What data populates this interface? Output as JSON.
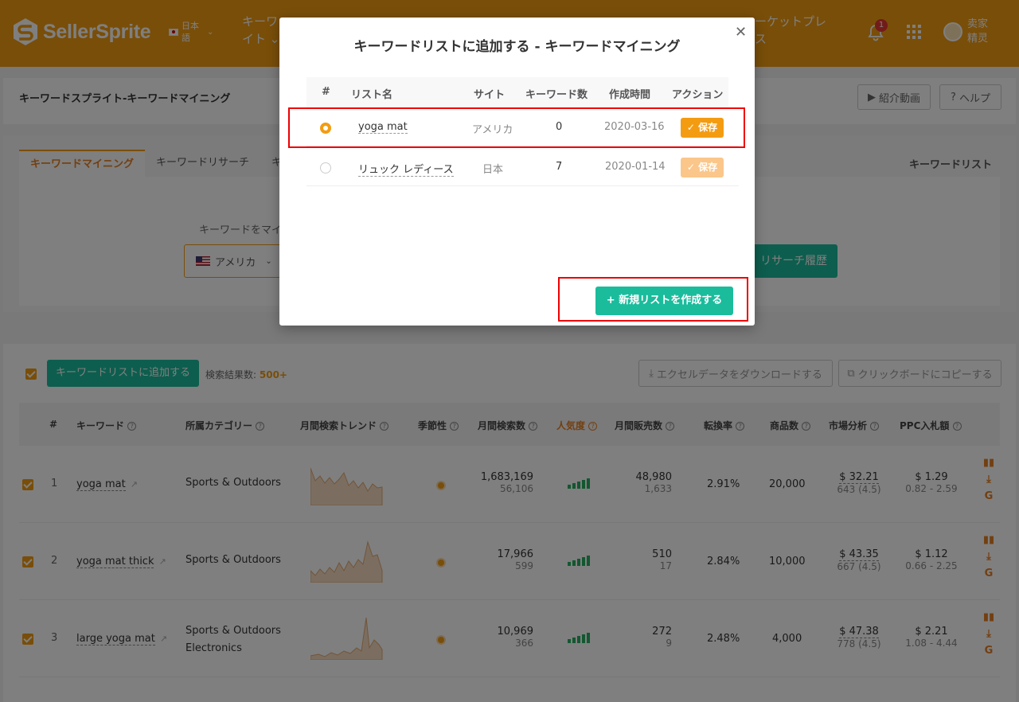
{
  "header": {
    "logo_text": "SellerSprite",
    "lang_line1": "日本",
    "lang_line2": "語",
    "nav_left_line1": "キーワ",
    "nav_left_line2": "イト ⌄",
    "nav_right_line1": "ーケットプレ",
    "nav_right_line2": "ス",
    "notification_count": "1",
    "user_line1": "卖家",
    "user_line2": "精灵"
  },
  "page": {
    "title": "キーワードスプライト-キーワードマイニング",
    "intro_video_label": "紹介動画",
    "help_label": "ヘルプ"
  },
  "tabs": {
    "items": [
      "キーワードマイニング",
      "キーワードリサーチ",
      "キ"
    ],
    "right": "キーワードリスト"
  },
  "search": {
    "label": "キーワードをマイ",
    "country": "アメリカ",
    "history_button": "リサーチ履歴"
  },
  "results": {
    "add_to_list_button": "キーワードリストに追加する",
    "count_label": "検索結果数:",
    "count_value": "500+",
    "excel_button": "エクセルデータをダウンロードする",
    "copy_button": "クリックボードにコピーする",
    "columns": [
      "#",
      "キーワード",
      "所属カテゴリー",
      "月間検索トレンド",
      "季節性",
      "月間検索数",
      "人気度",
      "月間販売数",
      "転換率",
      "商品数",
      "市場分析",
      "PPC入札額"
    ],
    "rows": [
      {
        "idx": "1",
        "keyword": "yoga mat",
        "cat1": "Sports & Outdoors",
        "cat2": "",
        "search": "1,683,169",
        "search_sub": "56,106",
        "sales": "48,980",
        "sales_sub": "1,633",
        "conv": "2.91%",
        "products": "20,000",
        "market": "$ 32.21",
        "market_sub": "643 (4.5)",
        "ppc": "$ 1.29",
        "ppc_sub": "0.82 - 2.59"
      },
      {
        "idx": "2",
        "keyword": "yoga mat thick",
        "cat1": "Sports & Outdoors",
        "cat2": "",
        "search": "17,966",
        "search_sub": "599",
        "sales": "510",
        "sales_sub": "17",
        "conv": "2.84%",
        "products": "10,000",
        "market": "$ 43.35",
        "market_sub": "667 (4.5)",
        "ppc": "$ 1.12",
        "ppc_sub": "0.66 - 2.25"
      },
      {
        "idx": "3",
        "keyword": "large yoga mat",
        "cat1": "Sports & Outdoors",
        "cat2": "Electronics",
        "search": "10,969",
        "search_sub": "366",
        "sales": "272",
        "sales_sub": "9",
        "conv": "2.48%",
        "products": "4,000",
        "market": "$ 47.38",
        "market_sub": "778 (4.5)",
        "ppc": "$ 2.21",
        "ppc_sub": "1.08 - 4.44"
      }
    ]
  },
  "modal": {
    "title": "キーワードリストに追加する - キーワードマイニング",
    "columns": [
      "#",
      "リスト名",
      "サイト",
      "キーワード数",
      "作成時間",
      "アクション"
    ],
    "rows": [
      {
        "name": "yoga mat",
        "site": "アメリカ",
        "count": "0",
        "created": "2020-03-16",
        "action": "保存",
        "selected": true
      },
      {
        "name": "リュック レディース",
        "site": "日本",
        "count": "7",
        "created": "2020-01-14",
        "action": "保存",
        "selected": false
      }
    ],
    "new_list_button": "新規リストを作成する"
  },
  "colors": {
    "brand_orange": "#f39c12",
    "teal": "#1abc9c",
    "highlight_red": "#e00000"
  }
}
